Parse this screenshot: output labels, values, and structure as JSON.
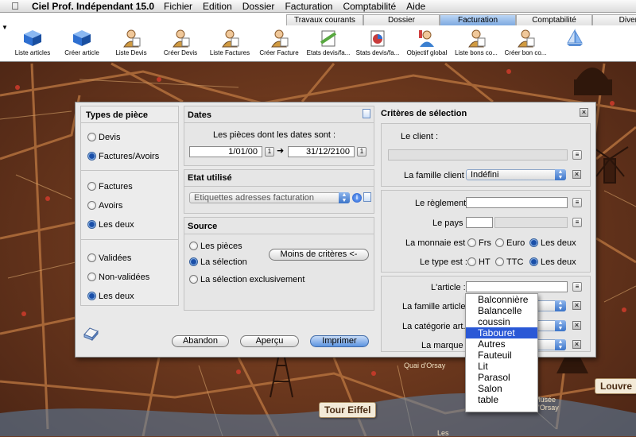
{
  "menubar": {
    "app_title": "Ciel Prof. Indépendant 15.0",
    "items": [
      "Fichier",
      "Edition",
      "Dossier",
      "Facturation",
      "Comptabilité",
      "Aide"
    ]
  },
  "toolbar": {
    "tabs": [
      {
        "label": "Travaux courants",
        "active": false
      },
      {
        "label": "Dossier",
        "active": false
      },
      {
        "label": "Facturation",
        "active": true
      },
      {
        "label": "Comptabilité",
        "active": false
      },
      {
        "label": "Diver",
        "active": false
      }
    ],
    "tools": [
      {
        "label": "Liste articles",
        "icon": "cube-icon"
      },
      {
        "label": "Créer article",
        "icon": "cube-add-icon"
      },
      {
        "label": "Liste Devis",
        "icon": "person-icon"
      },
      {
        "label": "Créer Devis",
        "icon": "person-add-icon"
      },
      {
        "label": "Liste Factures",
        "icon": "person-icon"
      },
      {
        "label": "Créer Facture",
        "icon": "person-add-icon"
      },
      {
        "label": "Etats devis/fa...",
        "icon": "report-icon"
      },
      {
        "label": "Stats devis/fa...",
        "icon": "stats-icon"
      },
      {
        "label": "Objectif global",
        "icon": "target-icon"
      },
      {
        "label": "Liste bons co...",
        "icon": "person-icon"
      },
      {
        "label": "Créer bon co...",
        "icon": "person-add-icon"
      },
      {
        "label": "",
        "icon": "sailboat-icon"
      }
    ]
  },
  "map": {
    "labels": [
      "Tour Eiffel",
      "Louvre"
    ],
    "small": [
      "Quai d'Orsay",
      "Musée d'Orsay",
      "Les"
    ]
  },
  "types": {
    "title": "Types de pièce",
    "group1": [
      {
        "label": "Devis",
        "on": false
      },
      {
        "label": "Factures/Avoirs",
        "on": true
      }
    ],
    "group2": [
      {
        "label": "Factures",
        "on": false
      },
      {
        "label": "Avoirs",
        "on": false
      },
      {
        "label": "Les deux",
        "on": true
      }
    ],
    "group3": [
      {
        "label": "Validées",
        "on": false
      },
      {
        "label": "Non-validées",
        "on": false
      },
      {
        "label": "Les deux",
        "on": true
      }
    ]
  },
  "dates": {
    "title": "Dates",
    "caption": "Les pièces dont les dates sont :",
    "from": "1/01/00",
    "to": "31/12/2100",
    "calendar_btn": "1"
  },
  "etat": {
    "title": "Etat utilisé",
    "selected": "Etiquettes adresses facturation"
  },
  "source": {
    "title": "Source",
    "options": [
      {
        "label": "Les pièces",
        "on": false
      },
      {
        "label": "La sélection",
        "on": true
      },
      {
        "label": "La sélection exclusivement",
        "on": false
      }
    ],
    "less_criteria": "Moins de critères <-"
  },
  "criteria": {
    "title": "Critères de sélection",
    "client_label": "Le client :",
    "famille_client_label": "La famille client :",
    "famille_client_value": "Indéfini",
    "reglement_label": "Le règlement :",
    "pays_label": "Le pays :",
    "monnaie_label": "La monnaie est :",
    "monnaie_options": [
      {
        "label": "Frs",
        "on": false
      },
      {
        "label": "Euro",
        "on": false
      },
      {
        "label": "Les deux",
        "on": true
      }
    ],
    "type_label": "Le type est :",
    "type_options": [
      {
        "label": "HT",
        "on": false
      },
      {
        "label": "TTC",
        "on": false
      },
      {
        "label": "Les deux",
        "on": true
      }
    ],
    "article_label": "L'article :",
    "famille_article_label": "La famille article :",
    "categorie_label": "La catégorie art. :",
    "marque_label": "La marque :"
  },
  "dropdown": {
    "options": [
      "Balconnière",
      "Balancelle",
      "coussin",
      "Tabouret",
      "Autres",
      "Fauteuil",
      "Lit",
      "Parasol",
      "Salon",
      "table"
    ],
    "selected_index": 3
  },
  "buttons": {
    "cancel": "Abandon",
    "preview": "Aperçu",
    "print": "Imprimer"
  },
  "colors": {
    "accent": "#2a58d6",
    "map_background": "#6b3a22"
  }
}
